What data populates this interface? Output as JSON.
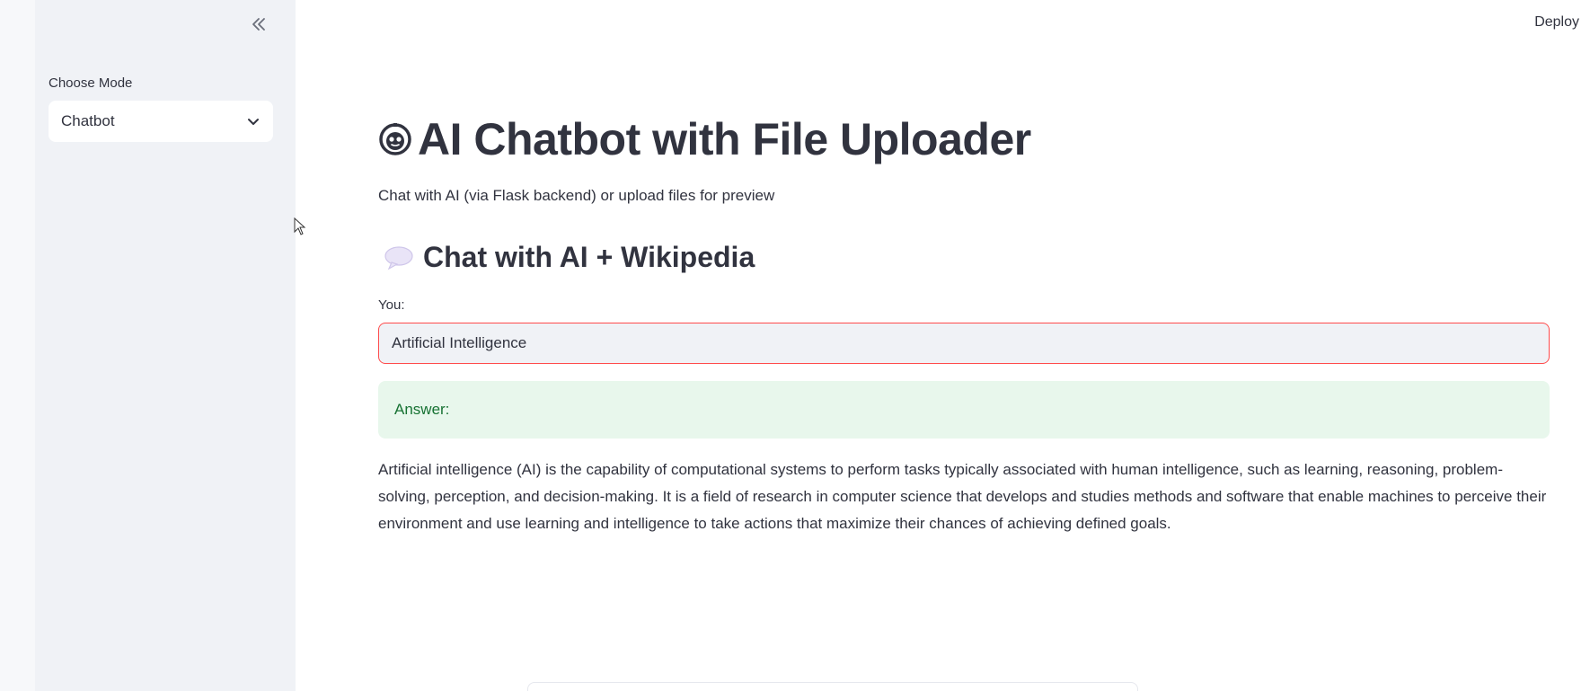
{
  "sidebar": {
    "mode_label": "Choose Mode",
    "mode_selected": "Chatbot"
  },
  "header": {
    "deploy_label": "Deploy"
  },
  "main": {
    "title": "AI Chatbot with File Uploader",
    "subtitle": "Chat with AI (via Flask backend) or upload files for preview",
    "section_title": "Chat with AI + Wikipedia",
    "input_label": "You:",
    "input_value": "Artificial Intelligence",
    "answer_label": "Answer:",
    "answer_text": "Artificial intelligence (AI) is the capability of computational systems to perform tasks typically associated with human intelligence, such as learning, reasoning, problem-solving, perception, and decision-making. It is a field of research in computer science that develops and studies methods and software that enable machines to perceive their environment and use learning and intelligence to take actions that maximize their chances of achieving defined goals."
  },
  "icons": {
    "title_icon": "robot-face-icon",
    "section_icon": "speech-balloon-icon",
    "collapse_icon": "double-chevron-left-icon",
    "select_icon": "chevron-down-icon"
  },
  "colors": {
    "sidebar_bg": "#f0f2f6",
    "input_focus_border": "#ff4b4b",
    "answer_bg": "#e8f7ec",
    "answer_text": "#177233"
  }
}
